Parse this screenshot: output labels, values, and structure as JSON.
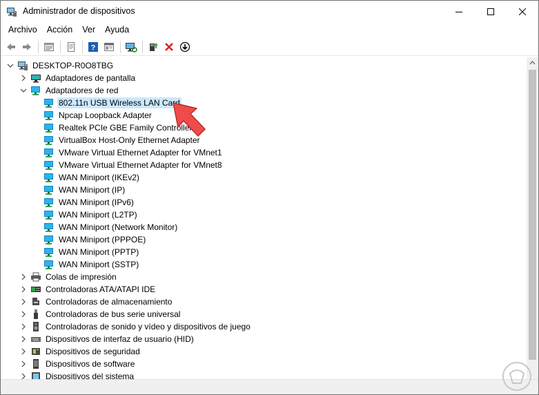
{
  "window": {
    "title": "Administrador de dispositivos"
  },
  "menu": [
    "Archivo",
    "Acción",
    "Ver",
    "Ayuda"
  ],
  "toolbar": {
    "buttons": [
      "back-icon",
      "forward-icon",
      "properties-icon",
      "print-icon",
      "help-icon",
      "view-icon",
      "scan-hardware-icon",
      "update-driver-icon",
      "uninstall-icon",
      "download-icon"
    ]
  },
  "tree": {
    "root": "DESKTOP-R0O8TBG",
    "categories_before": [
      {
        "label": "Adaptadores de pantalla",
        "icon": "display-adapter-icon",
        "expanded": false
      }
    ],
    "network": {
      "label": "Adaptadores de red",
      "expanded": true,
      "children": [
        "802.11n USB Wireless LAN Card",
        "Npcap Loopback Adapter",
        "Realtek PCIe GBE Family Controller",
        "VirtualBox Host-Only Ethernet Adapter",
        "VMware Virtual Ethernet Adapter for VMnet1",
        "VMware Virtual Ethernet Adapter for VMnet8",
        "WAN Miniport (IKEv2)",
        "WAN Miniport (IP)",
        "WAN Miniport (IPv6)",
        "WAN Miniport (L2TP)",
        "WAN Miniport (Network Monitor)",
        "WAN Miniport (PPPOE)",
        "WAN Miniport (PPTP)",
        "WAN Miniport (SSTP)"
      ],
      "selected_index": 0
    },
    "categories_after": [
      {
        "label": "Colas de impresión",
        "icon": "printer-icon"
      },
      {
        "label": "Controladoras ATA/ATAPI IDE",
        "icon": "ide-controller-icon"
      },
      {
        "label": "Controladoras de almacenamiento",
        "icon": "storage-controller-icon"
      },
      {
        "label": "Controladoras de bus serie universal",
        "icon": "usb-icon"
      },
      {
        "label": "Controladoras de sonido y vídeo y dispositivos de juego",
        "icon": "speaker-icon"
      },
      {
        "label": "Dispositivos de interfaz de usuario (HID)",
        "icon": "hid-icon"
      },
      {
        "label": "Dispositivos de seguridad",
        "icon": "security-device-icon"
      },
      {
        "label": "Dispositivos de software",
        "icon": "software-device-icon"
      },
      {
        "label": "Dispositivos del sistema",
        "icon": "system-device-icon"
      }
    ]
  },
  "colors": {
    "selection": "#cce8ff",
    "network_icon": "#1e90d8",
    "annotation": "#f04b4b"
  }
}
